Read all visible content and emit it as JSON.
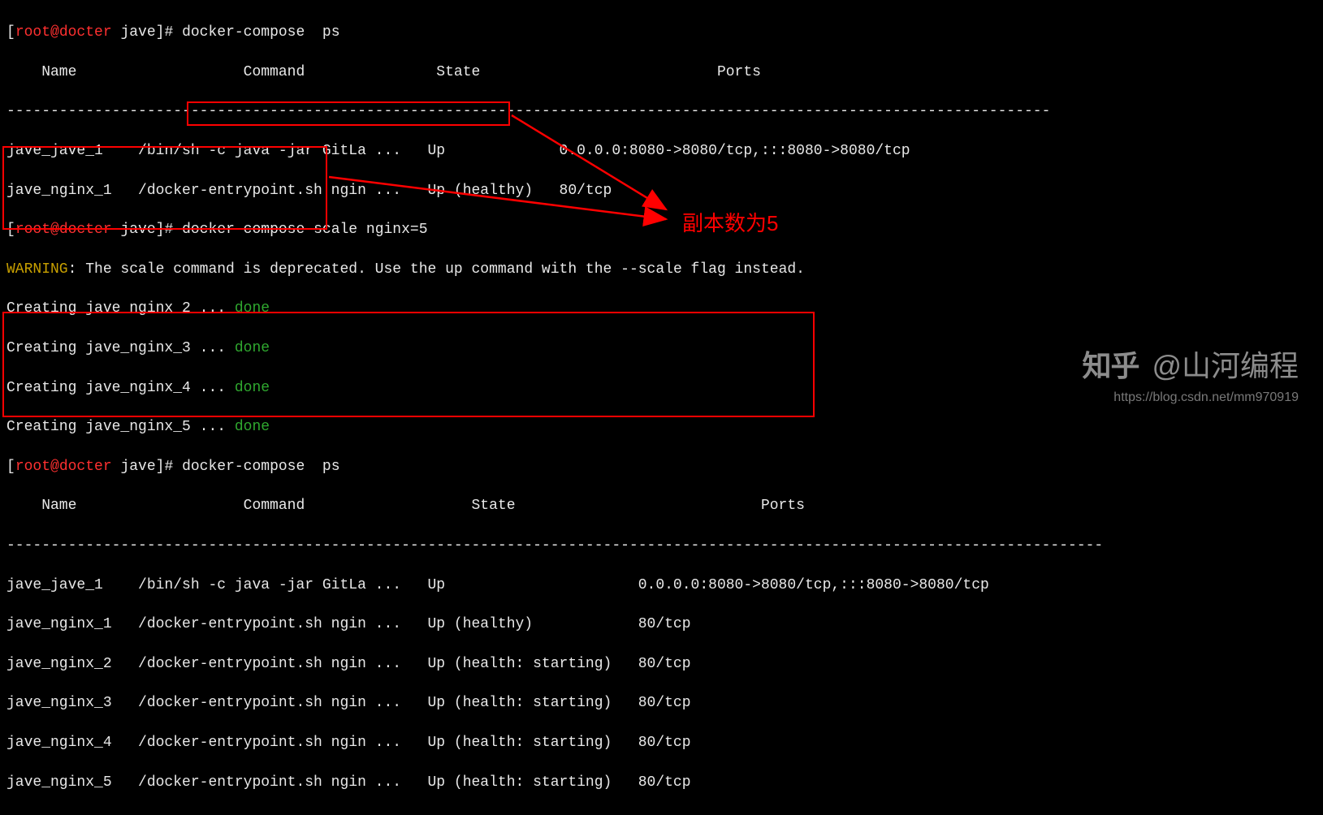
{
  "prompt1_pre": "[",
  "prompt1_user": "root@docter",
  "prompt1_path": " jave",
  "prompt1_post": "]# ",
  "cmd1": "docker-compose  ps",
  "header1_name": "    Name                   Command               State                           Ports                       ",
  "sep1": "-----------------------------------------------------------------------------------------------------------------------",
  "row1a": "jave_jave_1    /bin/sh -c java -jar GitLa ...   Up             0.0.0.0:8080->8080/tcp,:::8080->8080/tcp",
  "row1b": "jave_nginx_1   /docker-entrypoint.sh ngin ...   Up (healthy)   80/tcp                                          ",
  "cmd2": "docker-compose scale nginx=5",
  "warn_label": "WARNING",
  "warn_text": ": The scale command is deprecated. Use the up command with the --scale flag instead.",
  "creating_prefix": "Creating ",
  "creating_dots": " ... ",
  "creating_done": "done",
  "creating_items": [
    "jave_nginx_2",
    "jave_nginx_3",
    "jave_nginx_4",
    "jave_nginx_5"
  ],
  "cmd3": "docker-compose  ps",
  "header2_name": "    Name                   Command                   State                            Ports                       ",
  "sep2": "-----------------------------------------------------------------------------------------------------------------------------",
  "row2a": "jave_jave_1    /bin/sh -c java -jar GitLa ...   Up                      0.0.0.0:8080->8080/tcp,:::8080->8080/tcp",
  "row2b": "jave_nginx_1   /docker-entrypoint.sh ngin ...   Up (healthy)            80/tcp                                  ",
  "row2c": "jave_nginx_2   /docker-entrypoint.sh ngin ...   Up (health: starting)   80/tcp                                  ",
  "row2d": "jave_nginx_3   /docker-entrypoint.sh ngin ...   Up (health: starting)   80/tcp                                  ",
  "row2e": "jave_nginx_4   /docker-entrypoint.sh ngin ...   Up (health: starting)   80/tcp                                  ",
  "row2f": "jave_nginx_5   /docker-entrypoint.sh ngin ...   Up (health: starting)   80/tcp                                  ",
  "annotation_text": "副本数为5",
  "watermark_zhihu": "知乎",
  "watermark_author": "@山河编程",
  "watermark_url": "https://blog.csdn.net/mm970919"
}
